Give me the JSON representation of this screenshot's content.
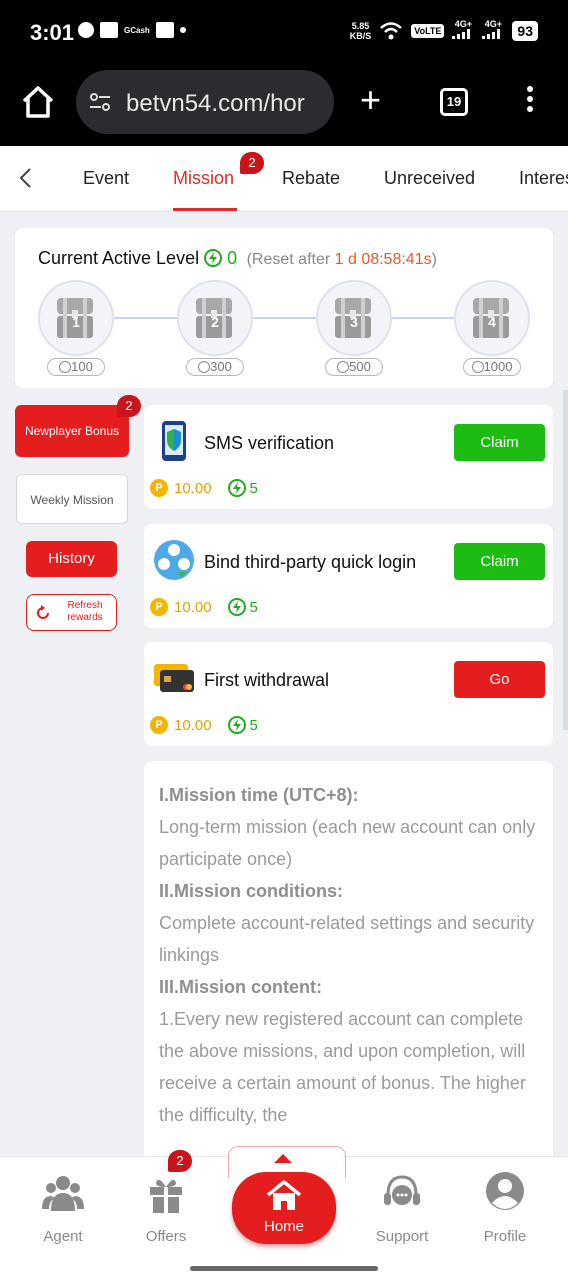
{
  "status_bar": {
    "time": "3:01",
    "gcash": "GCash",
    "net_speed_value": "5.85",
    "net_speed_unit": "KB/S",
    "volte": "VoLTE",
    "sim1": "4G+",
    "sim2": "4G+",
    "battery": "93"
  },
  "browser": {
    "url": "betvn54.com/hor",
    "tab_count": "19"
  },
  "tabs": [
    {
      "label": "Event"
    },
    {
      "label": "Mission",
      "badge": "2"
    },
    {
      "label": "Rebate"
    },
    {
      "label": "Unreceived"
    },
    {
      "label": "Interes"
    }
  ],
  "level": {
    "title": "Current Active Level",
    "current": "0",
    "reset_prefix": "(Reset after ",
    "reset_time": "1 d 08:58:41s",
    "reset_suffix": ")",
    "chests": [
      {
        "num": "1",
        "points": "100"
      },
      {
        "num": "2",
        "points": "300"
      },
      {
        "num": "3",
        "points": "500"
      },
      {
        "num": "4",
        "points": "1000"
      }
    ]
  },
  "sidebar": {
    "newplayer_label": "Newplayer Bonus",
    "newplayer_badge": "2",
    "weekly_label": "Weekly Mission",
    "history_label": "History",
    "refresh_label": "Refresh rewards"
  },
  "missions": [
    {
      "title": "SMS verification",
      "button": "Claim",
      "coin": "10.00",
      "xp": "5",
      "icon": "phone-shield-icon"
    },
    {
      "title": "Bind third-party quick login",
      "button": "Claim",
      "coin": "10.00",
      "xp": "5",
      "icon": "social-link-icon"
    },
    {
      "title": "First withdrawal",
      "button": "Go",
      "coin": "10.00",
      "xp": "5",
      "icon": "credit-card-icon"
    }
  ],
  "rules": {
    "h1": "I.Mission time (UTC+8):",
    "p1": "Long-term mission (each new account can only participate once)",
    "h2": "II.Mission conditions:",
    "p2": "Complete account-related settings and security linkings",
    "h3": "III.Mission content:",
    "p3": "1.Every new registered account can complete the above missions, and upon completion, will receive a certain amount of bonus. The higher the difficulty, the"
  },
  "bottom_nav": {
    "agent": "Agent",
    "offers": "Offers",
    "offers_badge": "2",
    "home": "Home",
    "support": "Support",
    "profile": "Profile"
  },
  "colors": {
    "accent": "#e41e1e",
    "claim": "#1cbc12",
    "coin": "#f4b400",
    "energy": "#22aa22"
  }
}
